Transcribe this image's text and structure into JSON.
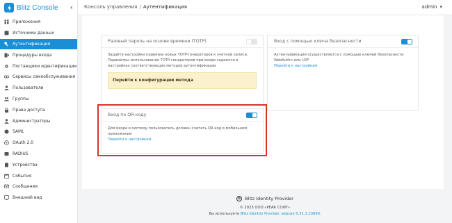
{
  "app": {
    "title": "Blitz Console",
    "collapse_icon": "‹"
  },
  "sidebar": {
    "items": [
      {
        "label": "Приложения",
        "icon": "apps-icon"
      },
      {
        "label": "Источники данных",
        "icon": "database-icon"
      },
      {
        "label": "Аутентификация",
        "icon": "key-icon",
        "active": true
      },
      {
        "label": "Процедуры входа",
        "icon": "login-icon"
      },
      {
        "label": "Поставщики идентификации",
        "icon": "gear-icon"
      },
      {
        "label": "Сервисы самообслуживания",
        "icon": "link-icon"
      },
      {
        "label": "Пользователи",
        "icon": "users-icon"
      },
      {
        "label": "Группы",
        "icon": "groups-icon"
      },
      {
        "label": "Права доступа",
        "icon": "lock-icon"
      },
      {
        "label": "Администраторы",
        "icon": "admin-icon"
      },
      {
        "label": "SAML",
        "icon": "saml-icon"
      },
      {
        "label": "OAuth 2.0",
        "icon": "oauth-icon"
      },
      {
        "label": "RADIUS",
        "icon": "radius-icon"
      },
      {
        "label": "Устройства",
        "icon": "devices-icon"
      },
      {
        "label": "События",
        "icon": "events-icon"
      },
      {
        "label": "Сообщения",
        "icon": "messages-icon"
      },
      {
        "label": "Внешний вид",
        "icon": "appearance-icon"
      }
    ]
  },
  "header": {
    "breadcrumb_parent": "Консоль управления",
    "breadcrumb_sep": "/",
    "breadcrumb_current": "Аутентификация",
    "user": "admin",
    "user_chevron": "▾"
  },
  "cards": {
    "totp": {
      "title": "Разовый пароль на основе времени (TOTP)",
      "enabled": false,
      "description": "Задайте настройки привязки новых TOTP-генераторов к учетной записи. Параметры использования TOTP-генераторов при входе задаются в настройках соответствующих методов аутентификации",
      "configure_label": "Перейти к конфигурации метода"
    },
    "security_key": {
      "title": "Вход с помощью ключа безопасности",
      "enabled": true,
      "description": "Аутентификация осуществляется с помощью ключей безопасности WebAuthn или U2F",
      "settings_link": "Перейти к настройкам"
    },
    "qr": {
      "title": "Вход по QR-коду",
      "enabled": true,
      "description": "Для входа в систему пользователь должен считать QR-код в мобильном приложении",
      "settings_link": "Перейти к настройкам"
    }
  },
  "footer": {
    "product": "Blitz Identity Provider",
    "copyright": "© 2025 ООО «РЕАК СОФТ»",
    "version_prefix": "Вы используете ",
    "version_link": "Blitz Identity Provider, версия 5.31.1.23890."
  },
  "colors": {
    "accent": "#1a8fd6",
    "highlight": "#d6322e",
    "warning_bg": "#fbf1cc"
  }
}
